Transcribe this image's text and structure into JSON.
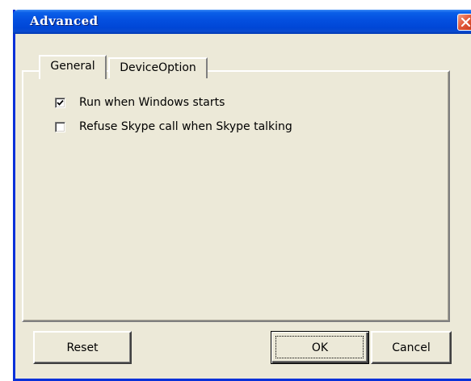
{
  "window": {
    "title": "Advanced",
    "close_icon": "close-icon"
  },
  "tabs": [
    {
      "label": "General",
      "selected": true
    },
    {
      "label": "DeviceOption",
      "selected": false
    }
  ],
  "general": {
    "options": [
      {
        "label": "Run when Windows starts",
        "checked": true
      },
      {
        "label": "Refuse Skype call when Skype talking",
        "checked": false
      }
    ]
  },
  "buttons": {
    "reset": "Reset",
    "ok": "OK",
    "cancel": "Cancel"
  },
  "colors": {
    "titlebar": "#0450e0",
    "dialog_bg": "#ece9d8",
    "close_button": "#e2593b"
  }
}
